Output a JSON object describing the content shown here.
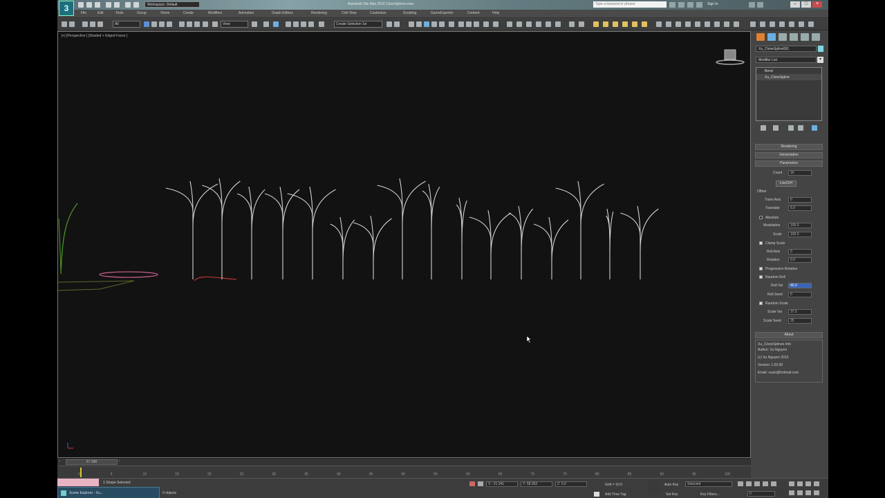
{
  "app": {
    "logo": "3",
    "window_title": "Autodesk 3ds Max 2016    CloneSplines.max",
    "workspace": "Workspace: Default",
    "search_placeholder": "Type a keyword or phrase",
    "sign_in": "Sign In"
  },
  "menu": [
    "File",
    "Edit",
    "Tools",
    "Group",
    "Views",
    "Create",
    "Modifiers",
    "Animation",
    "Graph Editors",
    "Rendering",
    "Civil View",
    "Customize",
    "Scripting",
    "GameExporter",
    "Content",
    "Help"
  ],
  "toolbar": {
    "selection_filter": "All",
    "ref_coord": "View",
    "named_selection": "Create Selection Se"
  },
  "viewport": {
    "label": "[+] [Perspective ] [Shaded + Edged Faces ]"
  },
  "command_panel": {
    "object_name": "Xu_CloneSpline001",
    "modifier_list": "Modifier List",
    "stack": [
      "Bend",
      "Xu_CloneSpline"
    ],
    "rollouts": {
      "rendering": "Rendering",
      "interpolation": "Interpolation",
      "parameters": "Parameters"
    },
    "params": {
      "count_label": "Count",
      "count_value": "16",
      "line_button": "LineOrH",
      "offset_label": "Offset",
      "trans_axis_label": "Trans Axis",
      "trans_axis_value": "0",
      "translate_label": "Translate",
      "translate_value": "5.0",
      "absolute_label": "Absolute",
      "modulation_label": "Modulation",
      "modulation_value": "100.0",
      "scale_label": "Scale",
      "scale_value": "100.0",
      "clamp_scale_label": "Clamp Scale",
      "roll_axis_label": "Roll Axis",
      "roll_axis_value": "0",
      "rotation_label": "Rotation",
      "rotation_value": "0.0",
      "progressive_rotation_label": "Progressive Rotation",
      "random_roll_label": "Random Roll",
      "roll_var_label": "Roll Var",
      "roll_var_value": "45.0",
      "roll_seed_label": "Roll Seed",
      "roll_seed_value": "0",
      "random_scale_label": "Random Scale",
      "scale_var_label": "Scale Var",
      "scale_var_value": "37.5",
      "scale_seed_label": "Scale Seed",
      "scale_seed_value": "25"
    },
    "about": {
      "title": "About",
      "lines": [
        "Xu_CloneSplines Info",
        "Author: Xu Nguyen",
        "(c) Xu Nguyen 2015",
        "Version: 1.03.00",
        "Email: xuxio@hotmail.com"
      ]
    }
  },
  "timeline": {
    "frame": "0 / 100",
    "ticks": [
      "0",
      "5",
      "10",
      "15",
      "20",
      "25",
      "30",
      "35",
      "40",
      "45",
      "50",
      "55",
      "60",
      "65",
      "70",
      "75",
      "80",
      "85",
      "90",
      "95",
      "100"
    ]
  },
  "status": {
    "scene_explorer": "Scene Explorer - Xu...",
    "selection": "1 Shape Selected",
    "objects": "0 objects",
    "grid": "Grid = 10.0",
    "auto_key": "Auto Key",
    "selected": "Selected",
    "set_key": "Set Key",
    "key_filters": "Key Filters...",
    "add_time_tag": "Add Time Tag",
    "x_field": "X: -21.341",
    "y_field": "Y: 58.362",
    "z_field": "Z: 0.0",
    "current_frame": "0"
  },
  "colors": {
    "viewport_bg": "#121212",
    "ui_bg": "#444444",
    "stem_color": "#d8d8d8",
    "accent": "#1f6e7c"
  }
}
